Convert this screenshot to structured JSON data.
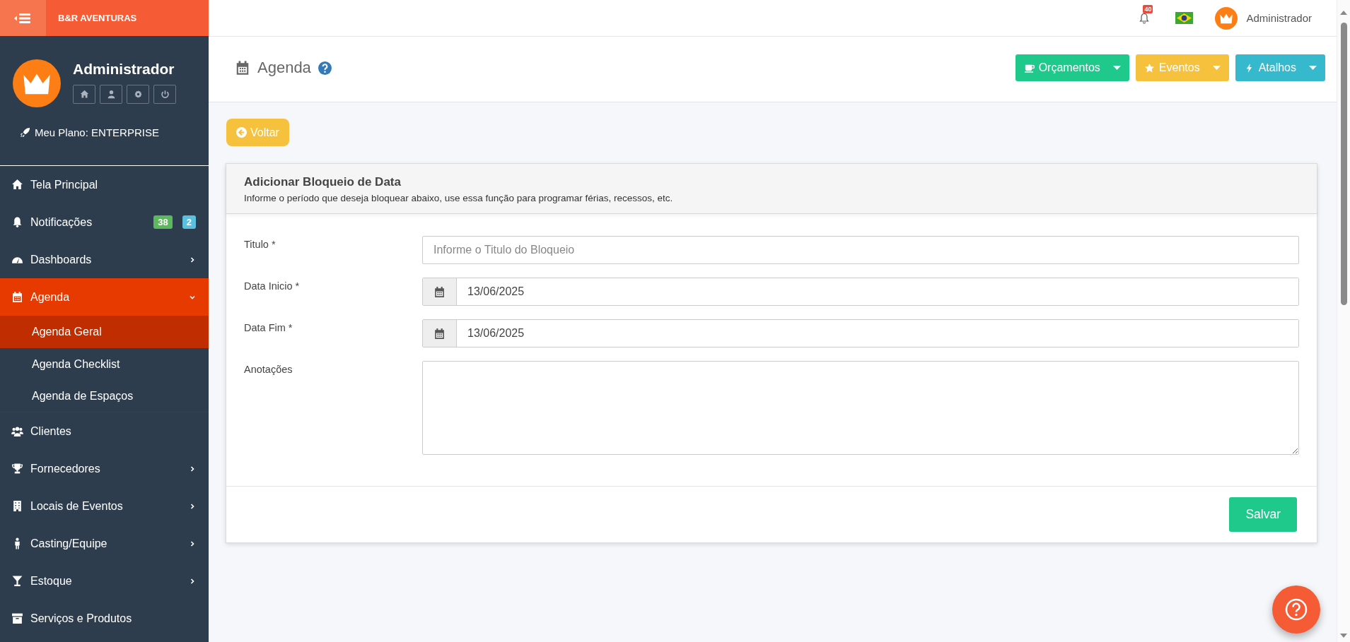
{
  "brand": {
    "name": "B&R AVENTURAS"
  },
  "profile": {
    "name": "Administrador",
    "plan": "Meu Plano: ENTERPRISE"
  },
  "sidebar": {
    "items": [
      {
        "label": "Tela Principal",
        "kind": "link"
      },
      {
        "label": "Notificações",
        "kind": "link",
        "badges": [
          {
            "text": "38",
            "color": "#5cb85c"
          },
          {
            "text": "2",
            "color": "#5bc0de"
          }
        ]
      },
      {
        "label": "Dashboards",
        "kind": "menu",
        "expanded": false
      },
      {
        "label": "Agenda",
        "kind": "menu",
        "expanded": true,
        "children": [
          {
            "label": "Agenda Geral",
            "selected": true
          },
          {
            "label": "Agenda Checklist",
            "selected": false
          },
          {
            "label": "Agenda de Espaços",
            "selected": false
          }
        ]
      },
      {
        "label": "Clientes",
        "kind": "link"
      },
      {
        "label": "Fornecedores",
        "kind": "menu",
        "expanded": false
      },
      {
        "label": "Locais de Eventos",
        "kind": "menu",
        "expanded": false
      },
      {
        "label": "Casting/Equipe",
        "kind": "menu",
        "expanded": false
      },
      {
        "label": "Estoque",
        "kind": "menu",
        "expanded": false
      },
      {
        "label": "Serviços e Produtos",
        "kind": "link"
      }
    ]
  },
  "topbar": {
    "notification_count": "40",
    "user": "Administrador"
  },
  "page_header": {
    "title": "Agenda",
    "buttons": [
      {
        "label": "Orçamentos",
        "color": "#1fc98b"
      },
      {
        "label": "Eventos",
        "color": "#f6c23e"
      },
      {
        "label": "Atalhos",
        "color": "#36b9cc"
      }
    ]
  },
  "back_button": {
    "label": "Voltar"
  },
  "form": {
    "title": "Adicionar Bloqueio de Data",
    "subtitle": "Informe o período que deseja bloquear abaixo, use essa função para programar férias, recessos, etc.",
    "fields": [
      {
        "label": "Titulo *",
        "kind": "text",
        "placeholder": "Informe o Titulo do Bloqueio"
      },
      {
        "label": "Data Inicio *",
        "kind": "date",
        "value": "13/06/2025"
      },
      {
        "label": "Data Fim *",
        "kind": "date",
        "value": "13/06/2025"
      },
      {
        "label": "Anotações",
        "kind": "textarea"
      }
    ],
    "submit": "Salvar"
  }
}
